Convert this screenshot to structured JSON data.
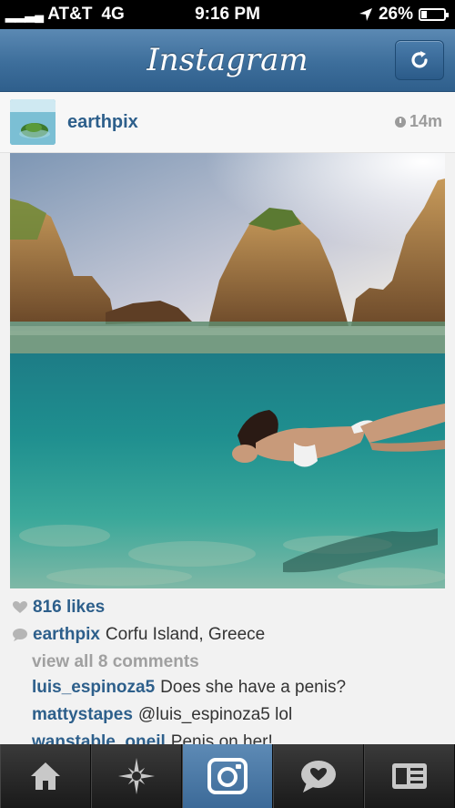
{
  "status_bar": {
    "carrier": "AT&T",
    "network": "4G",
    "time": "9:16 PM",
    "battery": "26%",
    "battery_level": 0.26
  },
  "nav": {
    "title": "Instagram"
  },
  "post": {
    "username": "earthpix",
    "time_ago": "14m",
    "likes": "816 likes",
    "caption_user": "earthpix",
    "caption_text": "Corfu Island, Greece",
    "view_comments": "view all 8 comments",
    "comments": [
      {
        "user": "luis_espinoza5",
        "text": "Does she have a penis?"
      },
      {
        "user": "mattystapes",
        "text": "@luis_espinoza5 lol"
      },
      {
        "user": "wanstable_oneil",
        "text": "Penis on her!"
      }
    ]
  },
  "tabs": [
    {
      "icon": "home-icon"
    },
    {
      "icon": "explore-icon"
    },
    {
      "icon": "camera-icon"
    },
    {
      "icon": "activity-icon"
    },
    {
      "icon": "profile-icon"
    }
  ],
  "colors": {
    "nav_blue": "#3d6e9b",
    "link_blue": "#2d5f8b"
  }
}
